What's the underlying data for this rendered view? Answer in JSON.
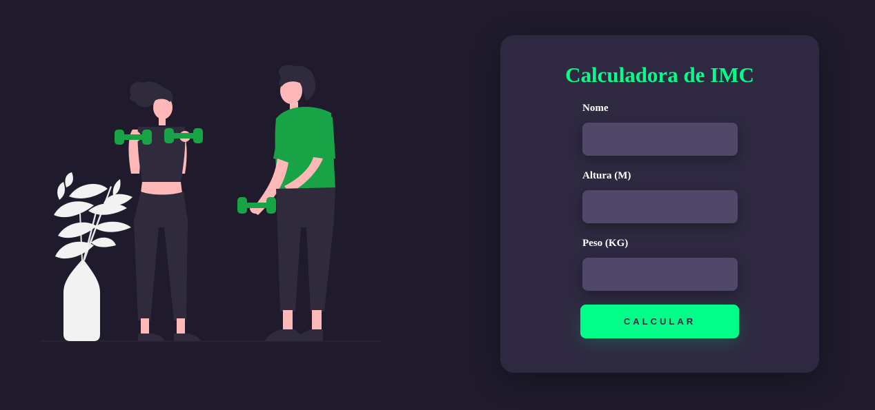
{
  "form": {
    "title": "Calculadora de IMC",
    "fields": [
      {
        "label": "Nome",
        "value": "",
        "placeholder": ""
      },
      {
        "label": "Altura (M)",
        "value": "",
        "placeholder": ""
      },
      {
        "label": "Peso (KG)",
        "value": "",
        "placeholder": ""
      }
    ],
    "button_label": "CALCULAR"
  },
  "illustration": {
    "icon": "fitness-people-illustration"
  },
  "colors": {
    "background": "#1f1b2d",
    "card": "#2e2941",
    "input": "#514769",
    "accent": "#00ff88",
    "shirt_green": "#19a347",
    "skin": "#ffb8b8",
    "clothing_dark": "#2f2b3d",
    "plant_white": "#f2f2f2"
  }
}
